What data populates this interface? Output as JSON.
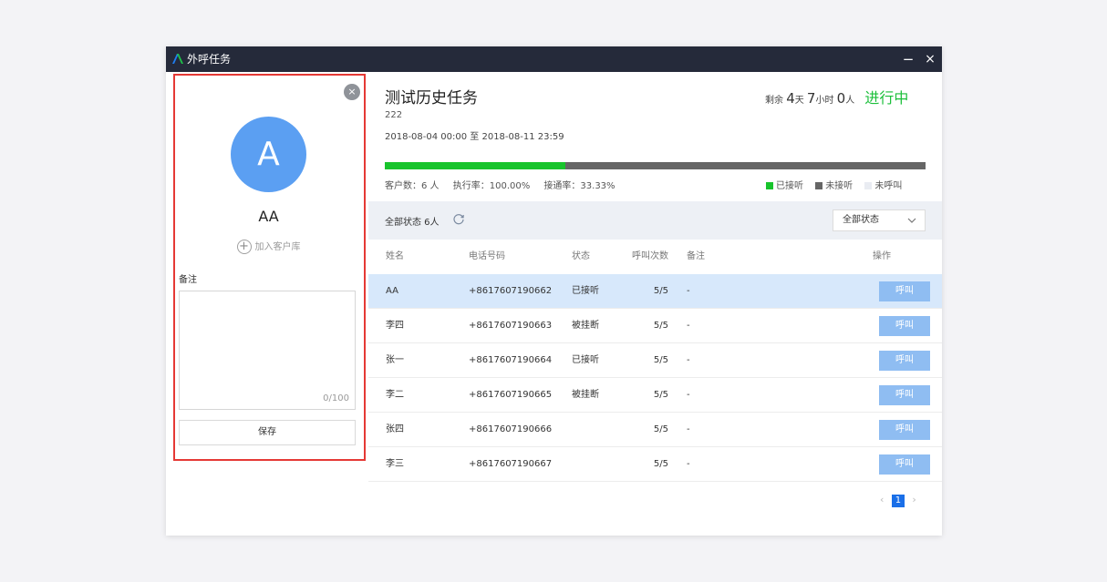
{
  "window": {
    "title": "外呼任务",
    "minimize": "−",
    "close": "×"
  },
  "customer_panel": {
    "close": "×",
    "avatar_letter": "A",
    "name": "AA",
    "add_to_library": "加入客户库",
    "notes_label": "备注",
    "notes_value": "",
    "notes_counter": "0/100",
    "save_label": "保存"
  },
  "task": {
    "title": "测试历史任务",
    "code": "222",
    "date_range": "2018-08-04 00:00 至 2018-08-11 23:59",
    "remaining_label": "剩余",
    "days": "4",
    "days_unit": "天",
    "hours": "7",
    "hours_unit": "小时",
    "people": "0",
    "people_unit": "人",
    "status": "进行中",
    "progress": 0.3333,
    "customers_stat": "客户数：6 人",
    "exec_rate_stat": "执行率：100.00%",
    "connect_rate_stat": "接通率：33.33%",
    "legend": [
      {
        "label": "已接听",
        "color": "#18c42c"
      },
      {
        "label": "未接听",
        "color": "#666666"
      },
      {
        "label": "未呼叫",
        "color": "#e9ecf2"
      }
    ]
  },
  "filter": {
    "count_label": "全部状态 6人",
    "select_value": "全部状态"
  },
  "table": {
    "headers": {
      "name": "姓名",
      "phone": "电话号码",
      "status": "状态",
      "count": "呼叫次数",
      "note": "备注",
      "op": "操作"
    },
    "rows": [
      {
        "name": "AA",
        "phone": "+8617607190662",
        "status": "已接听",
        "count": "5/5",
        "note": "-",
        "action": "呼叫"
      },
      {
        "name": "李四",
        "phone": "+8617607190663",
        "status": "被挂断",
        "count": "5/5",
        "note": "-",
        "action": "呼叫"
      },
      {
        "name": "张一",
        "phone": "+8617607190664",
        "status": "已接听",
        "count": "5/5",
        "note": "-",
        "action": "呼叫"
      },
      {
        "name": "李二",
        "phone": "+8617607190665",
        "status": "被挂断",
        "count": "5/5",
        "note": "-",
        "action": "呼叫"
      },
      {
        "name": "张四",
        "phone": "+8617607190666",
        "status": "",
        "count": "5/5",
        "note": "-",
        "action": "呼叫"
      },
      {
        "name": "李三",
        "phone": "+8617607190667",
        "status": "",
        "count": "5/5",
        "note": "-",
        "action": "呼叫"
      }
    ]
  },
  "pagination": {
    "prev": "‹",
    "current": "1",
    "next": "›"
  }
}
